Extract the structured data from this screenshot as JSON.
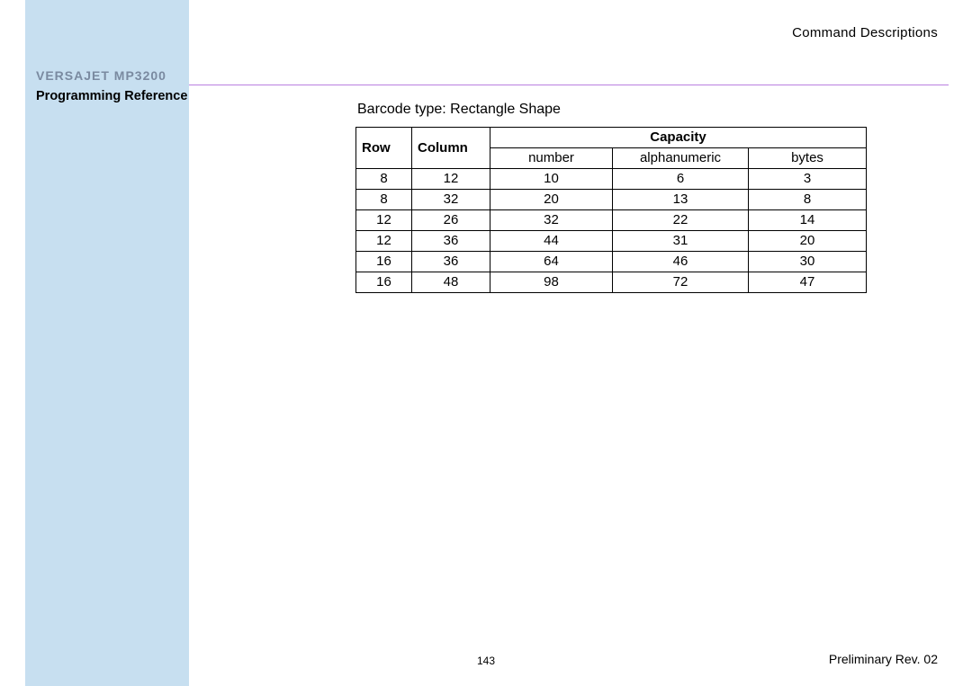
{
  "header": {
    "section": "Command  Descriptions"
  },
  "sidebar": {
    "model": "VERSAJET MP3200",
    "subtitle": "Programming Reference"
  },
  "content": {
    "caption": "Barcode type: Rectangle Shape",
    "table": {
      "head": {
        "row": "Row",
        "column": "Column",
        "capacity": "Capacity",
        "sub_number": "number",
        "sub_alpha": "alphanumeric",
        "sub_bytes": "bytes"
      },
      "rows": [
        {
          "row": "8",
          "col": "12",
          "num": "10",
          "alpha": "6",
          "bytes": "3"
        },
        {
          "row": "8",
          "col": "32",
          "num": "20",
          "alpha": "13",
          "bytes": "8"
        },
        {
          "row": "12",
          "col": "26",
          "num": "32",
          "alpha": "22",
          "bytes": "14"
        },
        {
          "row": "12",
          "col": "36",
          "num": "44",
          "alpha": "31",
          "bytes": "20"
        },
        {
          "row": "16",
          "col": "36",
          "num": "64",
          "alpha": "46",
          "bytes": "30"
        },
        {
          "row": "16",
          "col": "48",
          "num": "98",
          "alpha": "72",
          "bytes": "47"
        }
      ]
    }
  },
  "footer": {
    "page_number": "143",
    "revision": "Preliminary Rev. 02"
  }
}
